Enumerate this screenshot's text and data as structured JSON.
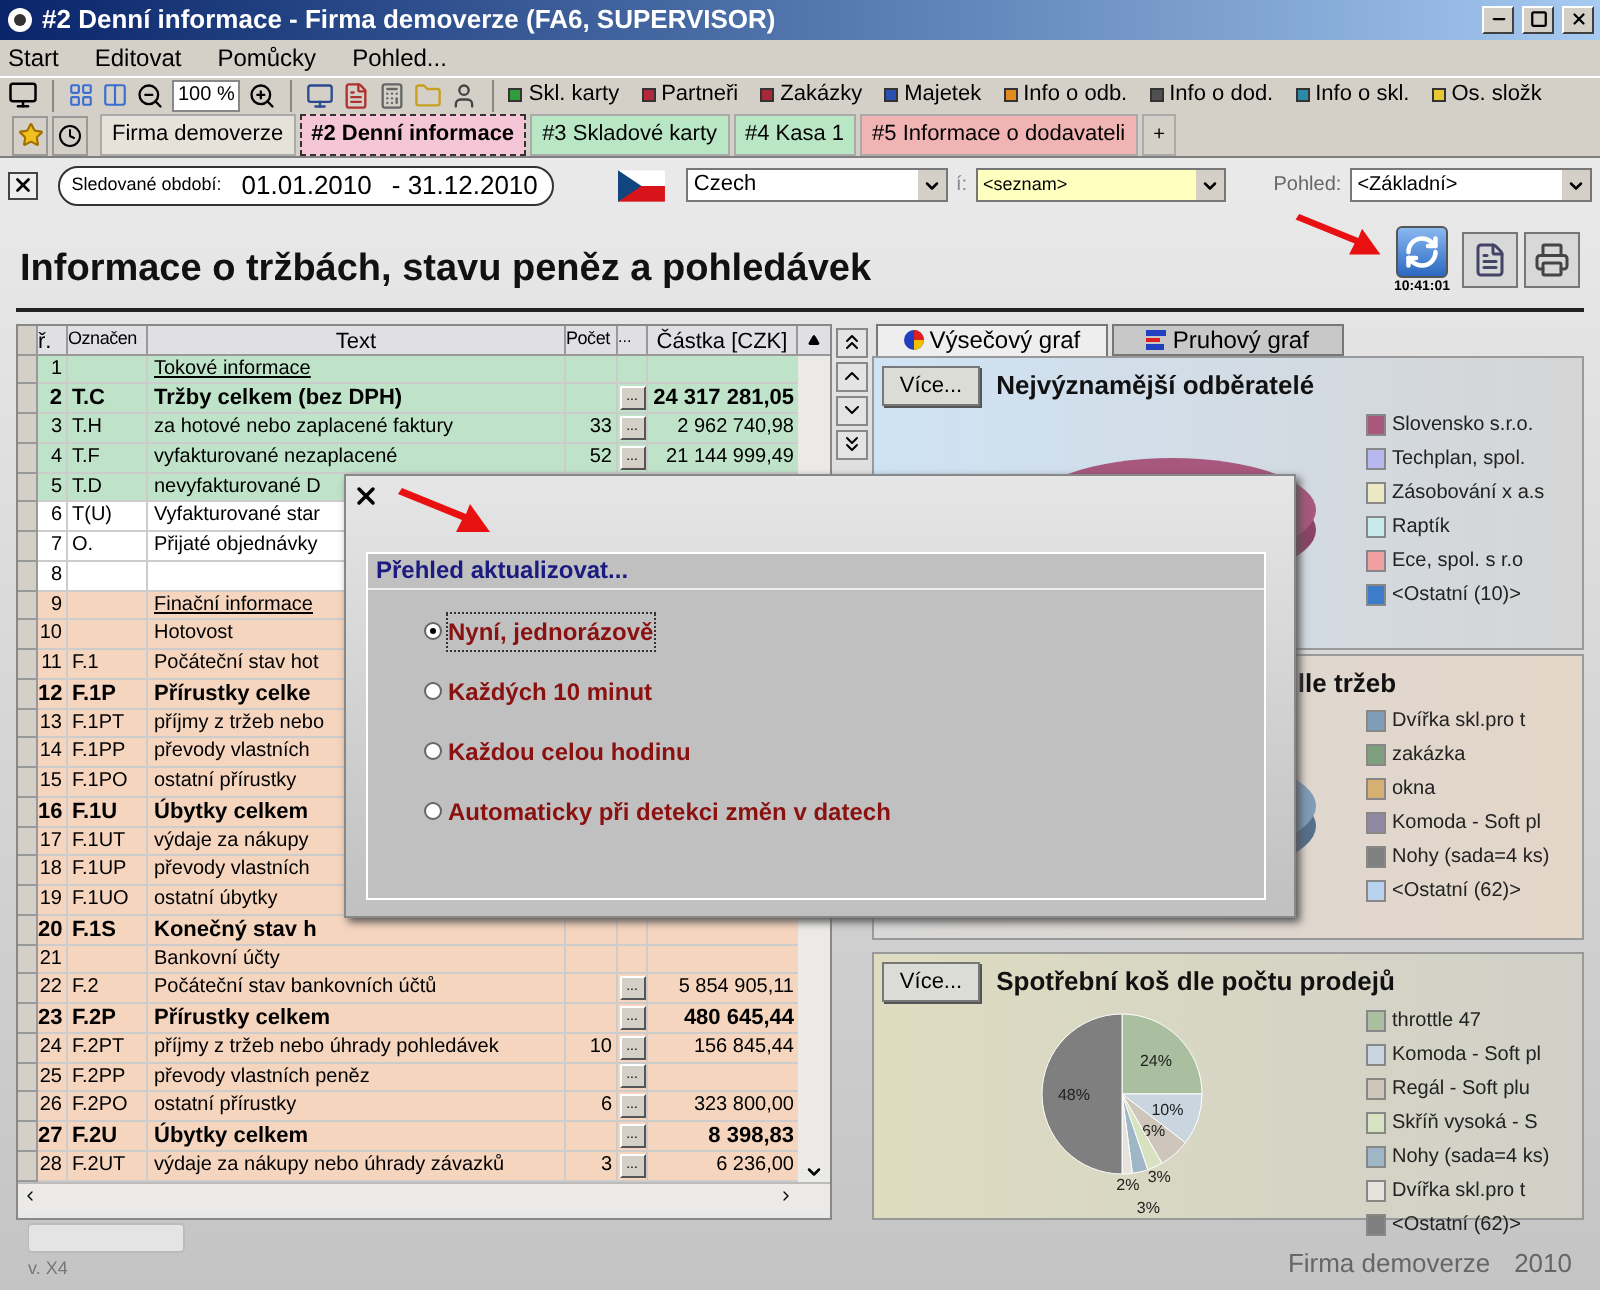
{
  "window": {
    "title": "#2 Denní informace - Firma demoverze (FA6, SUPERVISOR)"
  },
  "menu": [
    "Start",
    "Editovat",
    "Pomůcky",
    "Pohled..."
  ],
  "toolbar": {
    "zoom": "100 %",
    "links": [
      {
        "label": "Skl. karty",
        "color": "#2f9e3a"
      },
      {
        "label": "Partneři",
        "color": "#b0283a"
      },
      {
        "label": "Zakázky",
        "color": "#a8283a"
      },
      {
        "label": "Majetek",
        "color": "#2b4fb0"
      },
      {
        "label": "Info o odb.",
        "color": "#e08a20"
      },
      {
        "label": "Info o dod.",
        "color": "#505050"
      },
      {
        "label": "Info o skl.",
        "color": "#2a8aa8"
      },
      {
        "label": "Os. složk",
        "color": "#e8c830"
      }
    ]
  },
  "tabs": [
    {
      "label": "Firma demoverze",
      "selected": false,
      "color": "#e6e2da"
    },
    {
      "label": "#2 Denní informace",
      "selected": true,
      "color": "#f4c6d6"
    },
    {
      "label": "#3 Skladové karty",
      "selected": false,
      "color": "#b9e6c4"
    },
    {
      "label": "#4 Kasa 1",
      "selected": false,
      "color": "#b9e6c4"
    },
    {
      "label": "#5 Informace o dodavateli",
      "selected": false,
      "color": "#f0b4b4"
    }
  ],
  "add_tab": "+",
  "header": {
    "period_label": "Sledované období:",
    "period_from": "01.01.2010",
    "period_to": "- 31.12.2010",
    "language": "Czech",
    "filter_label": "í:",
    "filter_value": "<seznam>",
    "view_label": "Pohled:",
    "view_value": "<Základní>",
    "refresh_time": "10:41:01"
  },
  "page_title": "Informace o tržbách, stavu peněz a pohledávek",
  "table": {
    "columns": [
      "ř.",
      "Označen",
      "Text",
      "Počet",
      "...",
      "Částka [CZK]"
    ],
    "rows": [
      {
        "n": "1",
        "text": "Tokové informace",
        "kind": "heading",
        "color": "#bfe3c9"
      },
      {
        "n": "2",
        "code": "T.C",
        "text": "Tržby celkem (bez DPH)",
        "dots": "...",
        "amount": "24 317 281,05",
        "kind": "total",
        "color": "#bfe3c9"
      },
      {
        "n": "3",
        "code": "T.H",
        "text": "za hotové nebo zaplacené faktury",
        "count": "33",
        "dots": "...",
        "amount": "2 962 740,98",
        "kind": "item",
        "color": "#bfe3c9"
      },
      {
        "n": "4",
        "code": "T.F",
        "text": "vyfakturované nezaplacené",
        "count": "52",
        "dots": "...",
        "amount": "21 144 999,49",
        "kind": "item",
        "color": "#bfe3c9"
      },
      {
        "n": "5",
        "code": "T.D",
        "text": "nevyfakturované D",
        "kind": "item",
        "color": "#bfe3c9"
      },
      {
        "n": "6",
        "code": "T(U)",
        "text": "Vyfakturované star",
        "kind": "item",
        "color": "#ffffff"
      },
      {
        "n": "7",
        "code": "O.",
        "text": "Přijaté objednávky",
        "kind": "item",
        "color": "#ffffff"
      },
      {
        "n": "8",
        "kind": "item",
        "color": "#ffffff"
      },
      {
        "n": "9",
        "text": "Finační informace",
        "kind": "heading",
        "color": "#f6d5bf"
      },
      {
        "n": "10",
        "text": "Hotovost",
        "kind": "item",
        "color": "#f6d5bf"
      },
      {
        "n": "11",
        "code": "F.1",
        "text": "Počáteční stav hot",
        "kind": "item",
        "color": "#f6d5bf"
      },
      {
        "n": "12",
        "code": "F.1P",
        "text": "Přírustky celke",
        "kind": "total",
        "color": "#f6d5bf"
      },
      {
        "n": "13",
        "code": "F.1PT",
        "text": "příjmy z tržeb nebo",
        "kind": "item",
        "color": "#f6d5bf"
      },
      {
        "n": "14",
        "code": "F.1PP",
        "text": "převody vlastních",
        "kind": "item",
        "color": "#f6d5bf"
      },
      {
        "n": "15",
        "code": "F.1PO",
        "text": "ostatní přírustky",
        "kind": "item",
        "color": "#f6d5bf"
      },
      {
        "n": "16",
        "code": "F.1U",
        "text": "Úbytky celkem",
        "kind": "total",
        "color": "#f6d5bf"
      },
      {
        "n": "17",
        "code": "F.1UT",
        "text": "výdaje za nákupy",
        "kind": "item",
        "color": "#f6d5bf"
      },
      {
        "n": "18",
        "code": "F.1UP",
        "text": "převody vlastních",
        "kind": "item",
        "color": "#f6d5bf"
      },
      {
        "n": "19",
        "code": "F.1UO",
        "text": "ostatní úbytky",
        "kind": "item",
        "color": "#f6d5bf"
      },
      {
        "n": "20",
        "code": "F.1S",
        "text": "Konečný stav h",
        "kind": "total",
        "color": "#f6d5bf"
      },
      {
        "n": "21",
        "text": "Bankovní účty",
        "kind": "item",
        "color": "#f6d5bf"
      },
      {
        "n": "22",
        "code": "F.2",
        "text": "Počáteční stav bankovních účtů",
        "dots": "...",
        "amount": "5 854 905,11",
        "kind": "item",
        "color": "#f6d5bf"
      },
      {
        "n": "23",
        "code": "F.2P",
        "text": "Přírustky celkem",
        "dots": "...",
        "amount": "480 645,44",
        "kind": "total",
        "color": "#f6d5bf"
      },
      {
        "n": "24",
        "code": "F.2PT",
        "text": "příjmy z tržeb nebo úhrady pohledávek",
        "count": "10",
        "dots": "...",
        "amount": "156 845,44",
        "kind": "item",
        "color": "#f6d5bf"
      },
      {
        "n": "25",
        "code": "F.2PP",
        "text": "převody vlastních peněz",
        "dots": "...",
        "kind": "item",
        "color": "#f6d5bf"
      },
      {
        "n": "26",
        "code": "F.2PO",
        "text": "ostatní přírustky",
        "count": "6",
        "dots": "...",
        "amount": "323 800,00",
        "kind": "item",
        "color": "#f6d5bf"
      },
      {
        "n": "27",
        "code": "F.2U",
        "text": "Úbytky celkem",
        "dots": "...",
        "amount": "8 398,83",
        "kind": "total",
        "color": "#f6d5bf"
      },
      {
        "n": "28",
        "code": "F.2UT",
        "text": "výdaje za nákupy nebo úhrady závazků",
        "count": "3",
        "dots": "...",
        "amount": "6 236,00",
        "kind": "item",
        "color": "#f6d5bf"
      }
    ]
  },
  "chart_tabs": [
    {
      "label": "Výsečový graf",
      "selected": true
    },
    {
      "label": "Pruhový graf",
      "selected": false
    }
  ],
  "panels": [
    {
      "button": "Více...",
      "title": "Nejvýznamější odběratelé",
      "legend": [
        {
          "label": "Slovensko s.r.o.",
          "color": "#a8577d"
        },
        {
          "label": "Techplan, spol.",
          "color": "#b8b8f0"
        },
        {
          "label": "Zásobování x a.s",
          "color": "#ebe9c4"
        },
        {
          "label": "Raptík",
          "color": "#c8eaea"
        },
        {
          "label": "Ece, spol. s r.o",
          "color": "#f0a0a0"
        },
        {
          "label": "<Ostatní (10)>",
          "color": "#3d7cc9"
        }
      ]
    },
    {
      "title": "lle tržeb",
      "legend": [
        {
          "label": "Dvířka skl.pro t",
          "color": "#7f9bb5"
        },
        {
          "label": "zakázka",
          "color": "#7f9f7f"
        },
        {
          "label": "okna",
          "color": "#d6b070"
        },
        {
          "label": "Komoda - Soft pl",
          "color": "#9088a0"
        },
        {
          "label": "Nohy (sada=4 ks)",
          "color": "#808080"
        },
        {
          "label": "<Ostatní (62)>",
          "color": "#b9d3ef"
        }
      ]
    },
    {
      "button": "Více...",
      "legend": [
        {
          "label": "throttle 47",
          "color": "#a9bf9f"
        },
        {
          "label": "Komoda - Soft pl",
          "color": "#c9d6e0"
        },
        {
          "label": "Regál - Soft plu",
          "color": "#cfc6bb"
        },
        {
          "label": "Skříň vysoká - S",
          "color": "#d7e3c0"
        },
        {
          "label": "Nohy (sada=4 ks)",
          "color": "#9fb6c6"
        },
        {
          "label": "Dvířka skl.pro t",
          "color": "#e6e3df"
        },
        {
          "label": "<Ostatní (62)>",
          "color": "#7f7f7f"
        }
      ],
      "chart_data": {
        "type": "pie",
        "title": "Spotřební koš dle počtu prodejů",
        "series": [
          {
            "values": [
              25,
              10.42,
              6.25,
              3.12,
              3.13,
              2.08,
              50
            ]
          }
        ],
        "value_labels": [
          "24%",
          "10%",
          "6%",
          "3%",
          "3%",
          "2%",
          "48%"
        ]
      }
    }
  ],
  "dialog": {
    "title": "Přehled aktualizovat...",
    "options": [
      {
        "label": "Nyní, jednorázově",
        "selected": true
      },
      {
        "label": "Každých 10 minut",
        "selected": false
      },
      {
        "label": "Každou celou hodinu",
        "selected": false
      },
      {
        "label": "Automaticky při detekci změn v datech",
        "selected": false
      }
    ]
  },
  "footer": {
    "version": "v. X4",
    "company": "Firma demoverze",
    "year": "2010"
  }
}
